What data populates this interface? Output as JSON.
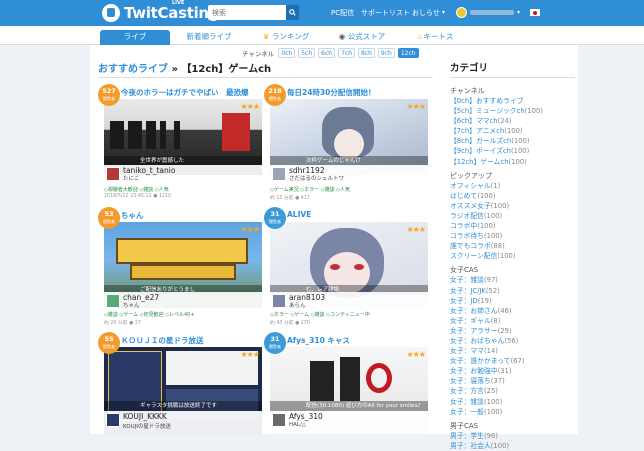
{
  "header": {
    "logo_text": "TwitCasting",
    "logo_badge": "LIVE",
    "search_placeholder": "検索",
    "nav": [
      "PC配信",
      "サポートリスト",
      "おしらせ"
    ],
    "chevron": "▾"
  },
  "tabs": [
    {
      "label": "ライブ",
      "active": true
    },
    {
      "label": "新着順ライブ",
      "active": false
    },
    {
      "label": "ランキング",
      "active": false,
      "icon": "crown-icon"
    },
    {
      "label": "公式ストア",
      "active": false,
      "icon": "store-icon"
    },
    {
      "label": "キートス",
      "active": false,
      "icon": "flame-icon"
    }
  ],
  "channel_bar": {
    "label": "チャンネル",
    "channels": [
      "0ch",
      "5ch",
      "6ch",
      "7ch",
      "8ch",
      "9ch",
      "12ch"
    ],
    "selected": "12ch"
  },
  "page_title": {
    "link": "おすすめライブ",
    "separator": "»",
    "current": "【12ch】ゲームch"
  },
  "cards": [
    {
      "title": "今夜のホラーはガチでやばい　最恐爆",
      "badge_num": "527",
      "badge_sub": "閲覧者",
      "stars": "★★★",
      "caption": "全世界が震撼した",
      "user": "taniko_t_tanio",
      "user_sub": "たにこ",
      "tags": "◇視聴者大歓迎 ◇雑談 ◇人気",
      "meta": "2018/5/22 23:45:12 ● 1210"
    },
    {
      "title": "毎日24時30分配信開始！",
      "badge_num": "218",
      "badge_sub": "閲覧者",
      "stars": "★★★",
      "caption": "次枠ゲームのじゃんけ",
      "user": "sdhr1192",
      "user_sub": "さだはるのシェルトワ",
      "tags": "◇ゲーム実況 ◇ホラー ◇雑談 ◇人気",
      "meta": "約 15 分前 ● 417"
    },
    {
      "title": "ちゃん",
      "badge_num": "53",
      "badge_sub": "閲覧者",
      "stars": "★★★",
      "caption": "ご配信ありがとうまし",
      "user": "chan_e27",
      "user_sub": "ちゃん",
      "tags": "◇雑談 ◇ゲーム ◇初見歓迎 ◇レベル40+",
      "meta": "約 20 分前 ● 37"
    },
    {
      "title": "ALIVE",
      "badge_num": "31",
      "badge_sub": "閲覧者",
      "stars": "★★★",
      "caption": "む、レア雑談",
      "user": "aran8103",
      "user_sub": "あらん",
      "tags": "◇ホラー ◇ゲーム ◇雑談 ◇コンティニュー中",
      "meta": "約 43 分前 ● 270"
    },
    {
      "title": "ＫＯＵＪＩの星ドラ放送",
      "badge_num": "55",
      "badge_sub": "閲覧者",
      "stars": "★★★",
      "caption": "ギャラスタ挑戦は放送終了です",
      "user": "KOUJI_KKKK",
      "user_sub": "KOUJIの星ドラ放送",
      "tags": "",
      "meta": ""
    },
    {
      "title": "Afys_310 キャス",
      "badge_num": "31",
      "badge_sub": "閲覧者",
      "stars": "★★★",
      "caption": "配信(30.1080)   遊び方のAll for your smiles♪",
      "user": "Afys_310",
      "user_sub": "HAL/△",
      "tags": "",
      "meta": ""
    }
  ],
  "sidebar": {
    "title": "カテゴリ",
    "sections": [
      {
        "head": "チャンネル",
        "items": [
          {
            "label": "【0ch】おすすめライブ",
            "count": ""
          },
          {
            "label": "【5ch】ミュージックch",
            "count": "(100)"
          },
          {
            "label": "【6ch】ママch",
            "count": "(24)"
          },
          {
            "label": "【7ch】アニメch",
            "count": "(100)"
          },
          {
            "label": "【8ch】ガールズch",
            "count": "(100)"
          },
          {
            "label": "【9ch】ボーイズch",
            "count": "(100)"
          },
          {
            "label": "【12ch】ゲームch",
            "count": "(100)"
          }
        ]
      },
      {
        "head": "ピックアップ",
        "items": [
          {
            "label": "オフィシャル",
            "count": "(1)"
          },
          {
            "label": "はじめて",
            "count": "(100)"
          },
          {
            "label": "オススメ女子",
            "count": "(100)"
          },
          {
            "label": "ラジオ配信",
            "count": "(100)"
          },
          {
            "label": "コラボ中",
            "count": "(100)"
          },
          {
            "label": "コラボ待ち",
            "count": "(100)"
          },
          {
            "label": "誰でもコラボ",
            "count": "(88)"
          },
          {
            "label": "スクリーン配信",
            "count": "(100)"
          }
        ]
      },
      {
        "head": "女子CAS",
        "items": [
          {
            "label": "女子：雑談",
            "count": "(97)"
          },
          {
            "label": "女子：JC/JK",
            "count": "(52)"
          },
          {
            "label": "女子：JD",
            "count": "(19)"
          },
          {
            "label": "女子：お姉さん",
            "count": "(46)"
          },
          {
            "label": "女子：ギャル",
            "count": "(8)"
          },
          {
            "label": "女子：アラサー",
            "count": "(29)"
          },
          {
            "label": "女子：おばちゃん",
            "count": "(56)"
          },
          {
            "label": "女子：ママ",
            "count": "(14)"
          },
          {
            "label": "女子：誰かかまって",
            "count": "(67)"
          },
          {
            "label": "女子：お勉強中",
            "count": "(31)"
          },
          {
            "label": "女子：寝落ち",
            "count": "(37)"
          },
          {
            "label": "女子：方言",
            "count": "(25)"
          },
          {
            "label": "女子：雑談",
            "count": "(100)"
          },
          {
            "label": "女子：一般",
            "count": "(100)"
          }
        ]
      },
      {
        "head": "男子CAS",
        "items": [
          {
            "label": "男子：学生",
            "count": "(96)"
          },
          {
            "label": "男子：社会人",
            "count": "(100)"
          }
        ]
      }
    ]
  }
}
